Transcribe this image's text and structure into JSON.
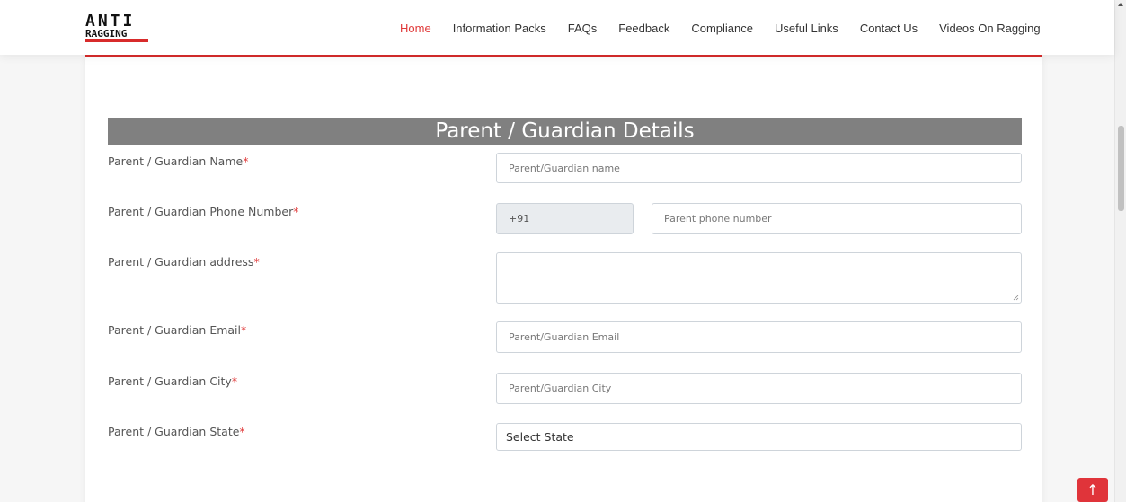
{
  "logo": {
    "line1": "ANTI",
    "line2": "RAGGING"
  },
  "nav": {
    "items": [
      {
        "label": "Home",
        "active": true
      },
      {
        "label": "Information Packs",
        "active": false
      },
      {
        "label": "FAQs",
        "active": false
      },
      {
        "label": "Feedback",
        "active": false
      },
      {
        "label": "Compliance",
        "active": false
      },
      {
        "label": "Useful Links",
        "active": false
      },
      {
        "label": "Contact Us",
        "active": false
      },
      {
        "label": "Videos On Ragging",
        "active": false
      }
    ]
  },
  "section": {
    "title": "Parent / Guardian Details"
  },
  "form": {
    "required_mark": "*",
    "name": {
      "label": "Parent / Guardian Name",
      "placeholder": "Parent/Guardian name",
      "value": ""
    },
    "phone": {
      "label": "Parent / Guardian Phone Number",
      "prefix": "+91",
      "placeholder": "Parent phone number",
      "value": ""
    },
    "address": {
      "label": "Parent / Guardian address",
      "value": ""
    },
    "email": {
      "label": "Parent / Guardian Email",
      "placeholder": "Parent/Guardian Email",
      "value": ""
    },
    "city": {
      "label": "Parent / Guardian City",
      "placeholder": "Parent/Guardian City",
      "value": ""
    },
    "state": {
      "label": "Parent / Guardian State",
      "selected": "Select State"
    }
  },
  "back_to_top": {
    "icon": "arrow-up-icon",
    "glyph": "↑"
  },
  "colors": {
    "accent": "#e03a3a",
    "header_bar": "#808080",
    "prefix_bg": "#e9ecef"
  }
}
